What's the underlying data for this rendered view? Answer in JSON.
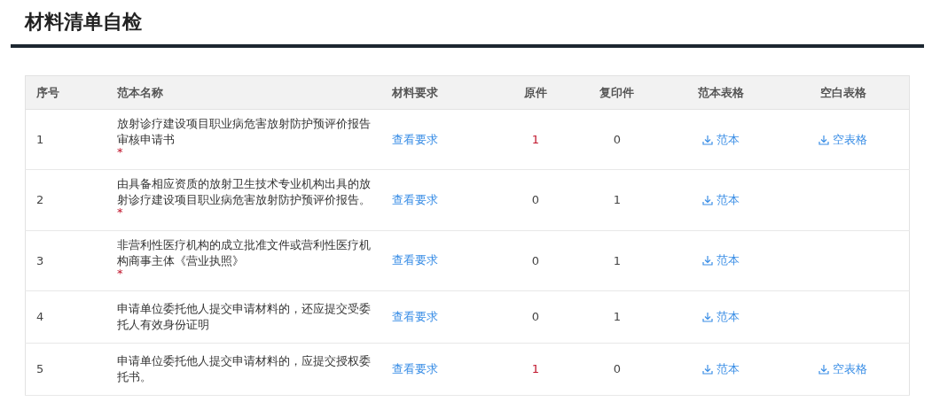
{
  "title": "材料清单自检",
  "columns": [
    "序号",
    "范本名称",
    "材料要求",
    "原件",
    "复印件",
    "范本表格",
    "空白表格"
  ],
  "rows": [
    {
      "no": "1",
      "name": "放射诊疗建设项目职业病危害放射防护预评价报告审核申请书",
      "mark": "*",
      "requirement": "查看要求",
      "original": {
        "text": "1",
        "highlight": true
      },
      "copies": "0",
      "template": "范本",
      "blank": "空表格"
    },
    {
      "no": "2",
      "name": "由具备相应资质的放射卫生技术专业机构出具的放射诊疗建设项目职业病危害放射防护预评价报告。",
      "mark": "*",
      "requirement": "查看要求",
      "original": {
        "text": "0",
        "highlight": false
      },
      "copies": "1",
      "template": "范本"
    },
    {
      "no": "3",
      "name": "非营利性医疗机构的成立批准文件或营利性医疗机构商事主体《营业执照》",
      "mark": "*",
      "requirement": "查看要求",
      "original": {
        "text": "0",
        "highlight": false
      },
      "copies": "1",
      "template": "范本"
    },
    {
      "no": "4",
      "name": "申请单位委托他人提交申请材料的，还应提交受委托人有效身份证明",
      "requirement": "查看要求",
      "original": {
        "text": "0",
        "highlight": false
      },
      "copies": "1",
      "template": "范本"
    },
    {
      "no": "5",
      "name": "申请单位委托他人提交申请材料的，应提交授权委托书。",
      "requirement": "查看要求",
      "original": {
        "text": "1",
        "highlight": true
      },
      "copies": "0",
      "template": "范本",
      "blank": "空表格"
    }
  ]
}
